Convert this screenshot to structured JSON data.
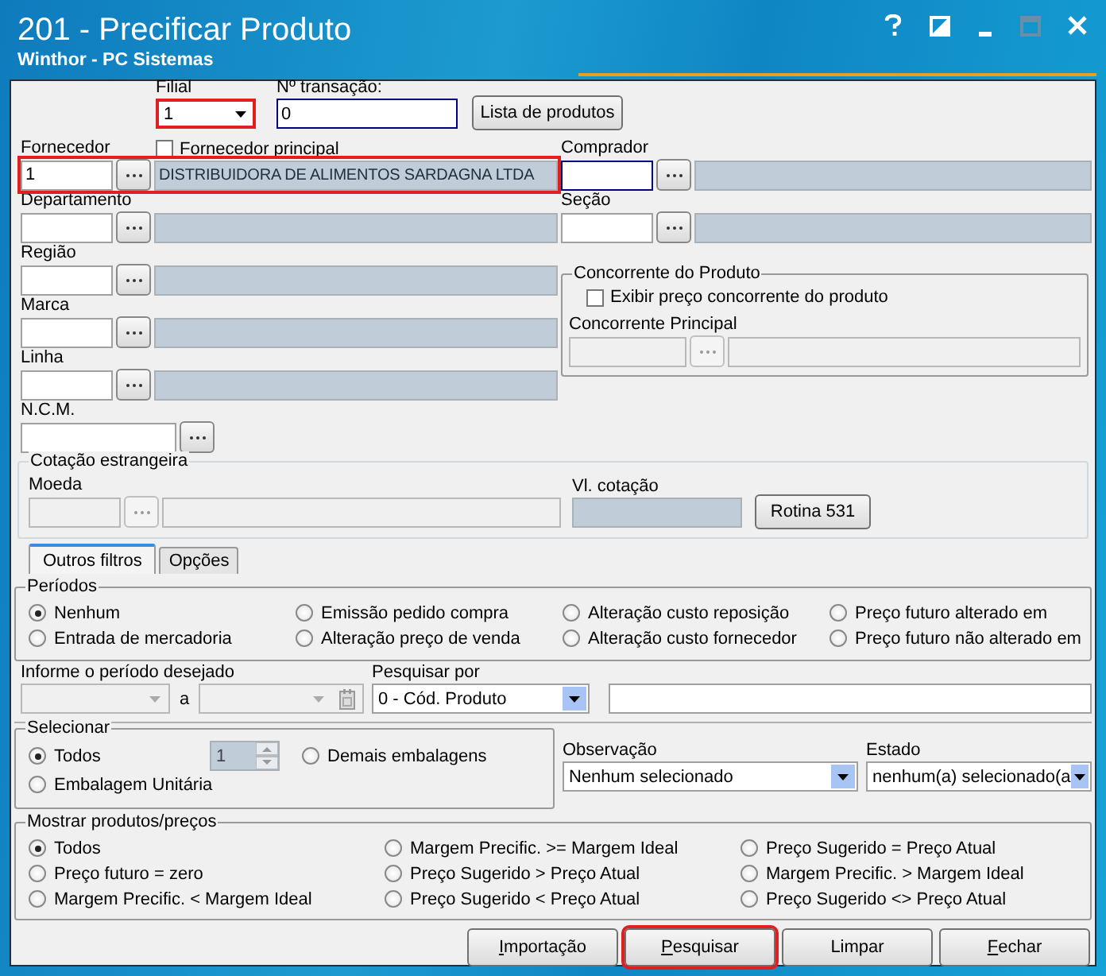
{
  "window": {
    "title": "201 - Precificar Produto",
    "subtitle": "Winthor - PC Sistemas"
  },
  "header": {
    "filial": {
      "label": "Filial",
      "value": "1",
      "highlighted": true
    },
    "transacao": {
      "label": "Nº transação:",
      "value": "0",
      "focused": true
    },
    "list_button": "Lista de produtos",
    "fornecedor_principal": {
      "label": "Fornecedor principal",
      "checked": false
    }
  },
  "lookups_left": [
    {
      "label": "Fornecedor",
      "code": "1",
      "description": "DISTRIBUIDORA DE ALIMENTOS SARDAGNA LTDA",
      "highlighted": true,
      "focused": false
    },
    {
      "label": "Departamento",
      "highlighted": false,
      "focused": false
    },
    {
      "label": "Região",
      "highlighted": false,
      "focused": false
    },
    {
      "label": "Marca",
      "highlighted": false,
      "focused": false
    },
    {
      "label": "Linha",
      "highlighted": false,
      "focused": false
    }
  ],
  "ncm": {
    "label": "N.C.M."
  },
  "lookups_right": [
    {
      "label": "Comprador",
      "highlighted": false,
      "focused": true
    },
    {
      "label": "Seção",
      "highlighted": false,
      "focused": false
    }
  ],
  "concorrente": {
    "title": "Concorrente do Produto",
    "checkbox": {
      "label": "Exibir preço concorrente do produto",
      "checked": false
    },
    "principal_label": "Concorrente Principal",
    "disabled": true
  },
  "cotacao": {
    "title": "Cotação estrangeira",
    "moeda_label": "Moeda",
    "valor_label": "Vl. cotação",
    "button": "Rotina 531",
    "disabled": true
  },
  "tabs": [
    {
      "label": "Outros filtros",
      "selected": true
    },
    {
      "label": "Opções",
      "selected": false
    }
  ],
  "periodos": {
    "title": "Períodos",
    "options": [
      {
        "label": "Nenhum",
        "selected": true
      },
      {
        "label": "Emissão pedido compra",
        "selected": false
      },
      {
        "label": "Alteração custo reposição",
        "selected": false
      },
      {
        "label": "Preço futuro alterado em",
        "selected": false
      },
      {
        "label": "Entrada de mercadoria",
        "selected": false
      },
      {
        "label": "Alteração preço de venda",
        "selected": false
      },
      {
        "label": "Alteração custo fornecedor",
        "selected": false
      },
      {
        "label": "Preço futuro não alterado em",
        "selected": false
      }
    ]
  },
  "periodo": {
    "label": "Informe o período desejado",
    "separator": "a",
    "disabled": true
  },
  "pesquisar_por": {
    "label": "Pesquisar por",
    "value": "0 - Cód. Produto"
  },
  "selecionar": {
    "title": "Selecionar",
    "quantity": "1",
    "options": [
      {
        "label": "Todos",
        "selected": true
      },
      {
        "label": "Demais embalagens",
        "selected": false
      },
      {
        "label": "Embalagem Unitária",
        "selected": false
      }
    ]
  },
  "observacao": {
    "label": "Observação",
    "value": "Nenhum selecionado"
  },
  "estado": {
    "label": "Estado",
    "value": "nenhum(a) selecionado(a"
  },
  "mostrar": {
    "title": "Mostrar produtos/preços",
    "options": [
      {
        "label": "Todos",
        "selected": true
      },
      {
        "label": "Margem Precific. >= Margem Ideal",
        "selected": false
      },
      {
        "label": "Preço Sugerido = Preço Atual",
        "selected": false
      },
      {
        "label": "Preço futuro = zero",
        "selected": false
      },
      {
        "label": "Preço Sugerido > Preço Atual",
        "selected": false
      },
      {
        "label": "Margem Precific. > Margem Ideal",
        "selected": false
      },
      {
        "label": "Margem Precific. < Margem Ideal",
        "selected": false
      },
      {
        "label": "Preço Sugerido < Preço Atual",
        "selected": false
      },
      {
        "label": "Preço Sugerido <> Preço Atual",
        "selected": false
      }
    ]
  },
  "buttons": [
    {
      "label": "Importação",
      "accelerator": true,
      "highlighted": false
    },
    {
      "label": "Pesquisar",
      "accelerator": true,
      "highlighted": true
    },
    {
      "label": "Limpar",
      "accelerator": false,
      "highlighted": false
    },
    {
      "label": "Fechar",
      "accelerator": true,
      "highlighted": false
    }
  ]
}
